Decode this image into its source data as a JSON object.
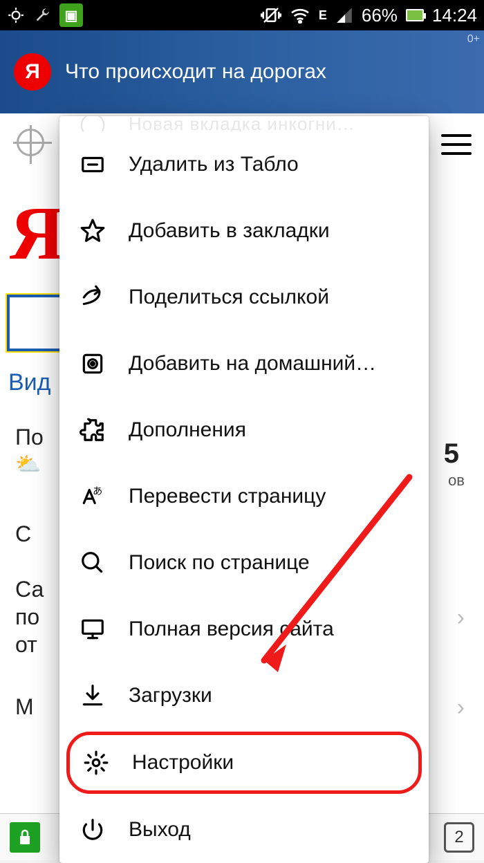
{
  "statusbar": {
    "battery_pct": "66%",
    "clock": "14:24"
  },
  "banner": {
    "logo_letter": "Я",
    "headline": "Что происходит на дорогах",
    "age": "0+"
  },
  "page": {
    "big_letter": "Я",
    "video_label": "Вид",
    "po_label": "По",
    "big_number": "5",
    "ov_label": "ов",
    "c_label": "С",
    "sa_label": "Са",
    "poi_label": "по",
    "ot_label": "от",
    "m_label": "М"
  },
  "bottombar": {
    "tab_count": "2"
  },
  "menu": {
    "truncated_top": "Новая вкладка инкогни…",
    "items": [
      {
        "icon": "remove-tile-icon",
        "label": "Удалить из Табло"
      },
      {
        "icon": "star-icon",
        "label": "Добавить в закладки"
      },
      {
        "icon": "share-icon",
        "label": "Поделиться ссылкой"
      },
      {
        "icon": "home-add-icon",
        "label": "Добавить на домашний…"
      },
      {
        "icon": "puzzle-icon",
        "label": "Дополнения"
      },
      {
        "icon": "translate-icon",
        "label": "Перевести страницу"
      },
      {
        "icon": "find-icon",
        "label": "Поиск по странице"
      },
      {
        "icon": "desktop-icon",
        "label": "Полная версия сайта"
      },
      {
        "icon": "download-icon",
        "label": "Загрузки"
      },
      {
        "icon": "gear-icon",
        "label": "Настройки",
        "highlight": true
      },
      {
        "icon": "power-icon",
        "label": "Выход"
      }
    ]
  }
}
